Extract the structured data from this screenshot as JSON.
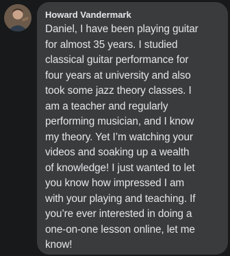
{
  "comment": {
    "author": "Howard Vandermark",
    "text": "Daniel, I have been playing guitar\nfor almost 35 years. I studied\nclassical guitar performance for\nfour years at university and also\ntook some jazz theory classes. I\nam a teacher and regularly\nperforming musician, and I know\nmy theory. Yet I’m watching your\nvideos and soaking up a wealth\nof knowledge! I just wanted to let\nyou know how impressed I am\nwith your playing and teaching. If\nyou’re ever interested in doing a\none-on-one lesson online, let me\nknow!"
  },
  "colors": {
    "background": "#18191a",
    "bubble": "#3a3b3c",
    "text": "#e4e6eb"
  }
}
